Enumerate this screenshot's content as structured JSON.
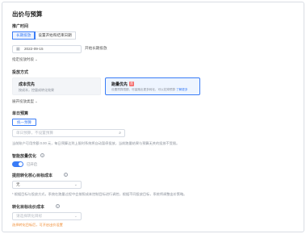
{
  "page": {
    "title": "出价与预算"
  },
  "promo_time": {
    "label": "推广时间",
    "options": [
      "长期投放",
      "设置开始和结束日期"
    ],
    "selected_index": 0,
    "start_date": "2022-09-15",
    "start_suffix": "开始长期投放",
    "custom_link": "指定投放时段"
  },
  "bid_method": {
    "label": "投放方式",
    "cards": [
      {
        "title": "成本优先",
        "desc": "按成本，控量成转化效果"
      },
      {
        "title": "跑量优先",
        "badge": "荐",
        "desc": "设置预算限额，尽量跑出更多转化，可以花掉预算",
        "link": "了解更多"
      }
    ],
    "selected_index": 1,
    "expand_link": "展开投放类型"
  },
  "daily_budget": {
    "label": "单日预算",
    "option": "统一预算",
    "placeholder": "单日预算，不设置预算",
    "hint": "当前账户可用余额 0.00 元，每日预算达到上限时系统将自动暂停投放，当前跑量结果与预算无关的投放不受限。"
  },
  "smart_expand": {
    "label": "智能放量优化",
    "toggle_on": true,
    "toggle_text": "已开启"
  },
  "deep_cost": {
    "label": "提前转化核心目标成本",
    "value": "无",
    "hint": "* 根据目标与投放方式，系统在跑量过程中会按照成本控制目标进行调控，根据不同投放目标，系统将调整出价策略。"
  },
  "conversion_cost": {
    "label": "转化目标出价成本",
    "placeholder": "请选择转化目标",
    "note": "选择转化目标后，可开启出价设置"
  }
}
